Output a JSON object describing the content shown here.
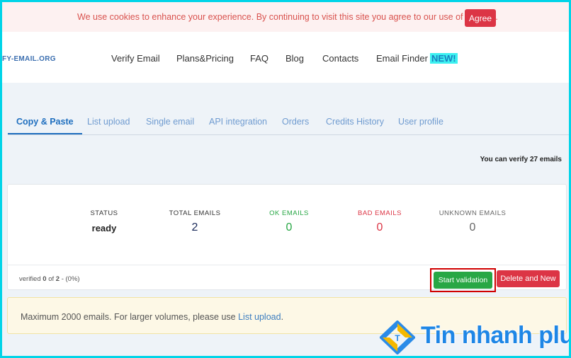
{
  "cookie": {
    "message": "We use cookies to enhance your experience. By continuing to visit this site you agree to our use of cookies.",
    "agree_label": "Agree"
  },
  "header": {
    "logo": "FY-EMAIL.ORG",
    "nav": {
      "verify_email": "Verify Email",
      "plans_pricing": "Plans&Pricing",
      "faq": "FAQ",
      "blog": "Blog",
      "contacts": "Contacts",
      "email_finder": "Email Finder",
      "new_badge": "NEW!"
    }
  },
  "tabs": {
    "copy_paste": "Copy & Paste",
    "list_upload": "List upload",
    "single_email": "Single email",
    "api_integration": "API integration",
    "orders": "Orders",
    "credits_history": "Credits History",
    "user_profile": "User profile"
  },
  "verify_count": "You can verify 27 emails",
  "stats": {
    "status_label": "STATUS",
    "status_value": "ready",
    "total_label": "TOTAL EMAILS",
    "total_value": "2",
    "ok_label": "OK EMAILS",
    "ok_value": "0",
    "bad_label": "BAD EMAILS",
    "bad_value": "0",
    "unknown_label": "UNKNOWN EMAILS",
    "unknown_value": "0"
  },
  "progress": {
    "prefix": "verified",
    "done": "0",
    "of": "of",
    "total": "2",
    "suffix": "- (0%)"
  },
  "buttons": {
    "start": "Start validation",
    "delete_new": "Delete and New"
  },
  "notice": {
    "text": "Maximum 2000 emails. For larger volumes, please use",
    "link": "List upload",
    "end": "."
  },
  "watermark": {
    "text": "Tin nhanh plus"
  },
  "colors": {
    "ok": "#28a745",
    "bad": "#dc3545",
    "unknown": "#666666",
    "primary": "#1f6fbf",
    "frame": "#00d4e8"
  }
}
